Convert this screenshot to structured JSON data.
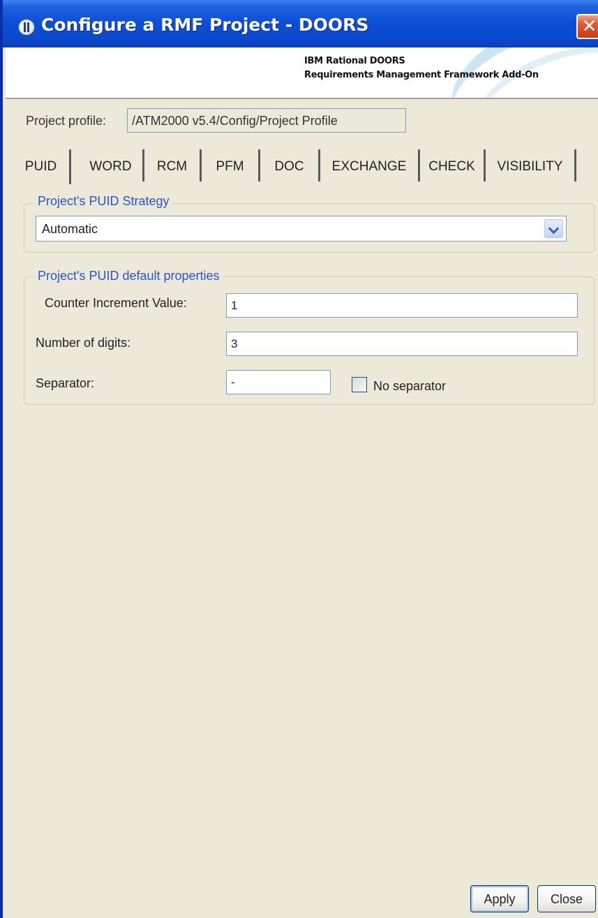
{
  "window": {
    "title": "Configure a RMF Project - DOORS",
    "close_glyph": "✕"
  },
  "banner": {
    "line1": "IBM Rational DOORS",
    "line2": "Requirements Management Framework Add-On"
  },
  "profile": {
    "label": "Project profile:",
    "value": "/ATM2000 v5.4/Config/Project Profile"
  },
  "tabs": [
    {
      "label": "PUID",
      "active": true
    },
    {
      "label": "WORD",
      "active": false
    },
    {
      "label": "RCM",
      "active": false
    },
    {
      "label": "PFM",
      "active": false
    },
    {
      "label": "DOC",
      "active": false
    },
    {
      "label": "EXCHANGE",
      "active": false
    },
    {
      "label": "CHECK",
      "active": false
    },
    {
      "label": "VISIBILITY",
      "active": false
    }
  ],
  "strategy": {
    "legend": "Project's PUID Strategy",
    "selected": "Automatic"
  },
  "defaults": {
    "legend": "Project's PUID default properties",
    "counter_label": "Counter Increment Value:",
    "counter_value": "1",
    "digits_label": "Number of digits:",
    "digits_value": "3",
    "separator_label": "Separator:",
    "separator_value": "-",
    "no_separator_label": "No separator",
    "no_separator_checked": false
  },
  "buttons": {
    "apply": "Apply",
    "close": "Close"
  },
  "colors": {
    "titlebar": "#0a49d0",
    "window_bg": "#ece9d8",
    "legend_text": "#2a55c8",
    "close_button": "#e0572d"
  }
}
